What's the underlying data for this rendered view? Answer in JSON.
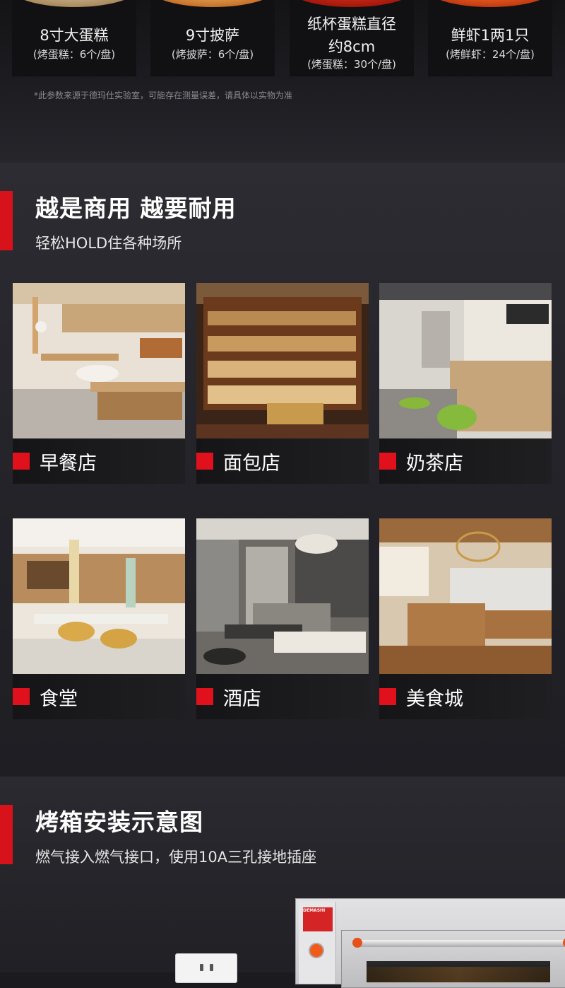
{
  "capacity_cards": [
    {
      "title_lines": [
        "8寸大蛋糕"
      ],
      "note": "(烤蛋糕：6个/盘)"
    },
    {
      "title_lines": [
        "9寸披萨"
      ],
      "note": "(烤披萨：6个/盘)"
    },
    {
      "title_lines": [
        "纸杯蛋糕直径",
        "约8cm"
      ],
      "note": "(烤蛋糕：30个/盘)"
    },
    {
      "title_lines": [
        "鲜虾1两1只"
      ],
      "note": "(烤鲜虾：24个/盘)"
    }
  ],
  "disclaimer": "*此参数来源于德玛仕实验室，可能存在测量误差，请具体以实物为准",
  "commercial_section": {
    "title": "越是商用 越要耐用",
    "subtitle": "轻松HOLD住各种场所",
    "venues": [
      {
        "label": "早餐店",
        "photo": "breakfast-shop-photo"
      },
      {
        "label": "面包店",
        "photo": "bakery-photo"
      },
      {
        "label": "奶茶店",
        "photo": "milk-tea-shop-photo"
      },
      {
        "label": "食堂",
        "photo": "canteen-photo"
      },
      {
        "label": "酒店",
        "photo": "hotel-photo"
      },
      {
        "label": "美食城",
        "photo": "food-court-photo"
      }
    ]
  },
  "install_section": {
    "title": "烤箱安装示意图",
    "subtitle": "燃气接入燃气接口，使用10A三孔接地插座",
    "oven_brand": "DEMASHI"
  },
  "colors": {
    "accent_red": "#d8121b",
    "card_bg": "#121214",
    "page_bg": "#1b1b1f"
  }
}
